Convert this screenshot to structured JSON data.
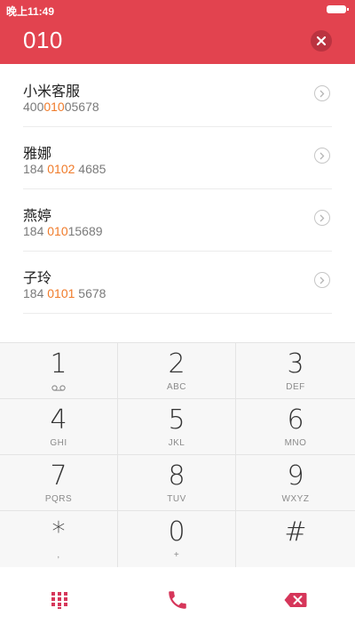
{
  "status_bar": {
    "time": "晚上11:49"
  },
  "dialer": {
    "dialed_number": "010"
  },
  "results": [
    {
      "name": "小米客服",
      "number_pre": "400",
      "number_match": "010",
      "number_post": "05678"
    },
    {
      "name": "雅娜",
      "number_pre": "184 ",
      "number_match": "0102",
      "number_post": " 4685"
    },
    {
      "name": "燕婷",
      "number_pre": "184 ",
      "number_match": "010",
      "number_post": "15689"
    },
    {
      "name": "子玲",
      "number_pre": "184 ",
      "number_match": "0101",
      "number_post": " 5678"
    }
  ],
  "keypad": [
    {
      "digit": "1",
      "letters": ""
    },
    {
      "digit": "2",
      "letters": "ABC"
    },
    {
      "digit": "3",
      "letters": "DEF"
    },
    {
      "digit": "4",
      "letters": "GHI"
    },
    {
      "digit": "5",
      "letters": "JKL"
    },
    {
      "digit": "6",
      "letters": "MNO"
    },
    {
      "digit": "7",
      "letters": "PQRS"
    },
    {
      "digit": "8",
      "letters": "TUV"
    },
    {
      "digit": "9",
      "letters": "WXYZ"
    },
    {
      "digit": "*",
      "letters": ","
    },
    {
      "digit": "0",
      "letters": "+"
    },
    {
      "digit": "#",
      "letters": ""
    }
  ],
  "colors": {
    "accent": "#e2434f",
    "highlight": "#f07b2a",
    "action": "#d6365a"
  },
  "icons": {
    "clear": "close-icon",
    "detail": "chevron-right-icon",
    "voicemail": "voicemail-icon",
    "keypad_toggle": "dialpad-icon",
    "call": "phone-icon",
    "delete": "backspace-icon"
  }
}
